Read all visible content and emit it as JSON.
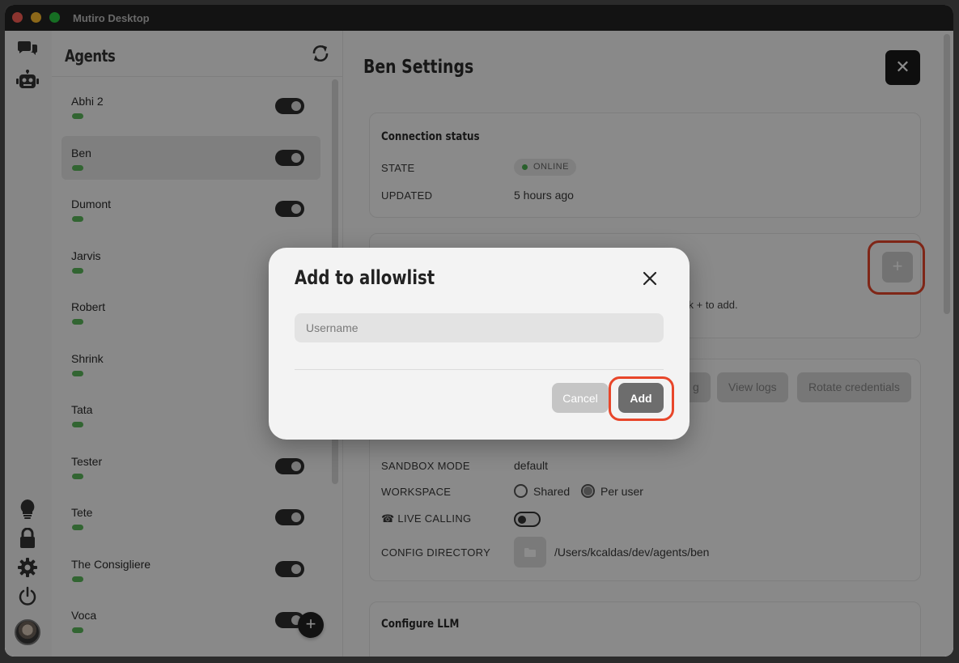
{
  "window": {
    "title": "Mutiro Desktop"
  },
  "agents_panel": {
    "title": "Agents",
    "items": [
      {
        "name": "Abhi 2",
        "selected": false
      },
      {
        "name": "Ben",
        "selected": true
      },
      {
        "name": "Dumont",
        "selected": false
      },
      {
        "name": "Jarvis",
        "selected": false
      },
      {
        "name": "Robert",
        "selected": false
      },
      {
        "name": "Shrink",
        "selected": false
      },
      {
        "name": "Tata",
        "selected": false
      },
      {
        "name": "Tester",
        "selected": false
      },
      {
        "name": "Tete",
        "selected": false
      },
      {
        "name": "The Consigliere",
        "selected": false
      },
      {
        "name": "Voca",
        "selected": false
      }
    ],
    "add_label": "+"
  },
  "settings": {
    "title": "Ben Settings",
    "close_label": "✕",
    "connection": {
      "title": "Connection status",
      "state_label": "STATE",
      "state_value": "ONLINE",
      "updated_label": "UPDATED",
      "updated_value": "5 hours ago"
    },
    "allowlist": {
      "add_label": "+",
      "hint_partial": "ck + to add."
    },
    "actions": {
      "partial_label": "g",
      "view_logs": "View logs",
      "rotate_credentials": "Rotate credentials"
    },
    "sandbox_label": "SANDBOX MODE",
    "sandbox_value": "default",
    "workspace_label": "WORKSPACE",
    "workspace_options": [
      "Shared",
      "Per user"
    ],
    "workspace_selected": "Per user",
    "live_calling_label": "LIVE CALLING",
    "live_calling_icon": "☎",
    "config_dir_label": "CONFIG DIRECTORY",
    "config_dir_value": "/Users/kcaldas/dev/agents/ben",
    "llm_title": "Configure LLM"
  },
  "modal": {
    "title": "Add to allowlist",
    "close_label": "✕",
    "username_placeholder": "Username",
    "username_value": "",
    "cancel_label": "Cancel",
    "add_label": "Add"
  },
  "colors": {
    "highlight": "#e8462a",
    "online": "#4caf50",
    "agent_status": "#5cb85c"
  }
}
